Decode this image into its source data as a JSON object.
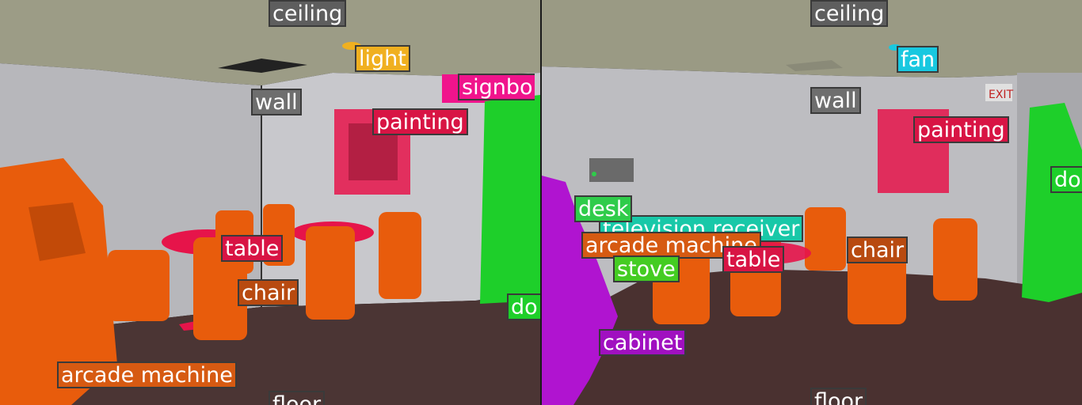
{
  "panels": {
    "left": {
      "labels": {
        "ceiling": "ceiling",
        "light": "light",
        "signboard": "signbo",
        "wall": "wall",
        "painting": "painting",
        "table": "table",
        "chair": "chair",
        "door": "do",
        "arcade_machine": "arcade machine",
        "floor": "floor"
      }
    },
    "right": {
      "labels": {
        "ceiling": "ceiling",
        "fan": "fan",
        "wall": "wall",
        "painting": "painting",
        "door": "do",
        "desk": "desk",
        "television_receiver": "television receiver",
        "arcade_machine": "arcade machine",
        "table": "table",
        "chair": "chair",
        "stove": "stove",
        "cabinet": "cabinet",
        "floor": "floor"
      },
      "exit_sign": "EXIT"
    }
  },
  "colors": {
    "ceiling": "#5e5e5e",
    "light": "#f0b020",
    "signboard": "#f0148c",
    "wall": "#6e6e6e",
    "painting": "#e6144a",
    "table": "#e6144a",
    "chair": "#e85c0c",
    "door": "#1ecf2a",
    "arcade_machine": "#e85c0c",
    "floor": "#5a3b36",
    "fan": "#18c8e0",
    "desk": "#2fcc4a",
    "television_receiver": "#18c8a8",
    "stove": "#44cc22",
    "cabinet": "#b014d0"
  }
}
